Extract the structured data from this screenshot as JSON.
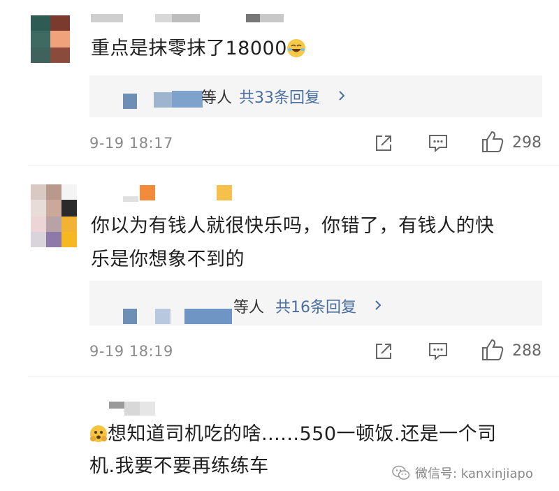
{
  "comments": [
    {
      "text": "重点是抹零抹了18000",
      "reply_summary": "等人",
      "reply_count": "共33条回复",
      "time": "9-19 18:17",
      "likes": "298"
    },
    {
      "text_line1": "你以为有钱人就很快乐吗，你错了，有钱人的快",
      "text_line2": "乐是你想象不到的",
      "reply_summary": "等人",
      "reply_count": "共16条回复",
      "time": "9-19 18:19",
      "likes": "288"
    },
    {
      "text_line1": "想知道司机吃的啥......550一顿饭.还是一个司",
      "text_line2": "机.我要不要再练练车"
    }
  ],
  "icons": {
    "share": "share-icon",
    "comment": "comment-icon",
    "like": "thumbs-up-icon",
    "chevron": "chevron-right-icon",
    "emoji": "laughing-emoji-icon",
    "crying": "cold-sweat-emoji-icon",
    "wechat": "wechat-logo-icon"
  },
  "watermark": "微信号: kanxinjiapo",
  "colors": {
    "link": "#4a6ea0",
    "meta": "#8a8a8a",
    "reply_bg": "#f5f5f5"
  }
}
